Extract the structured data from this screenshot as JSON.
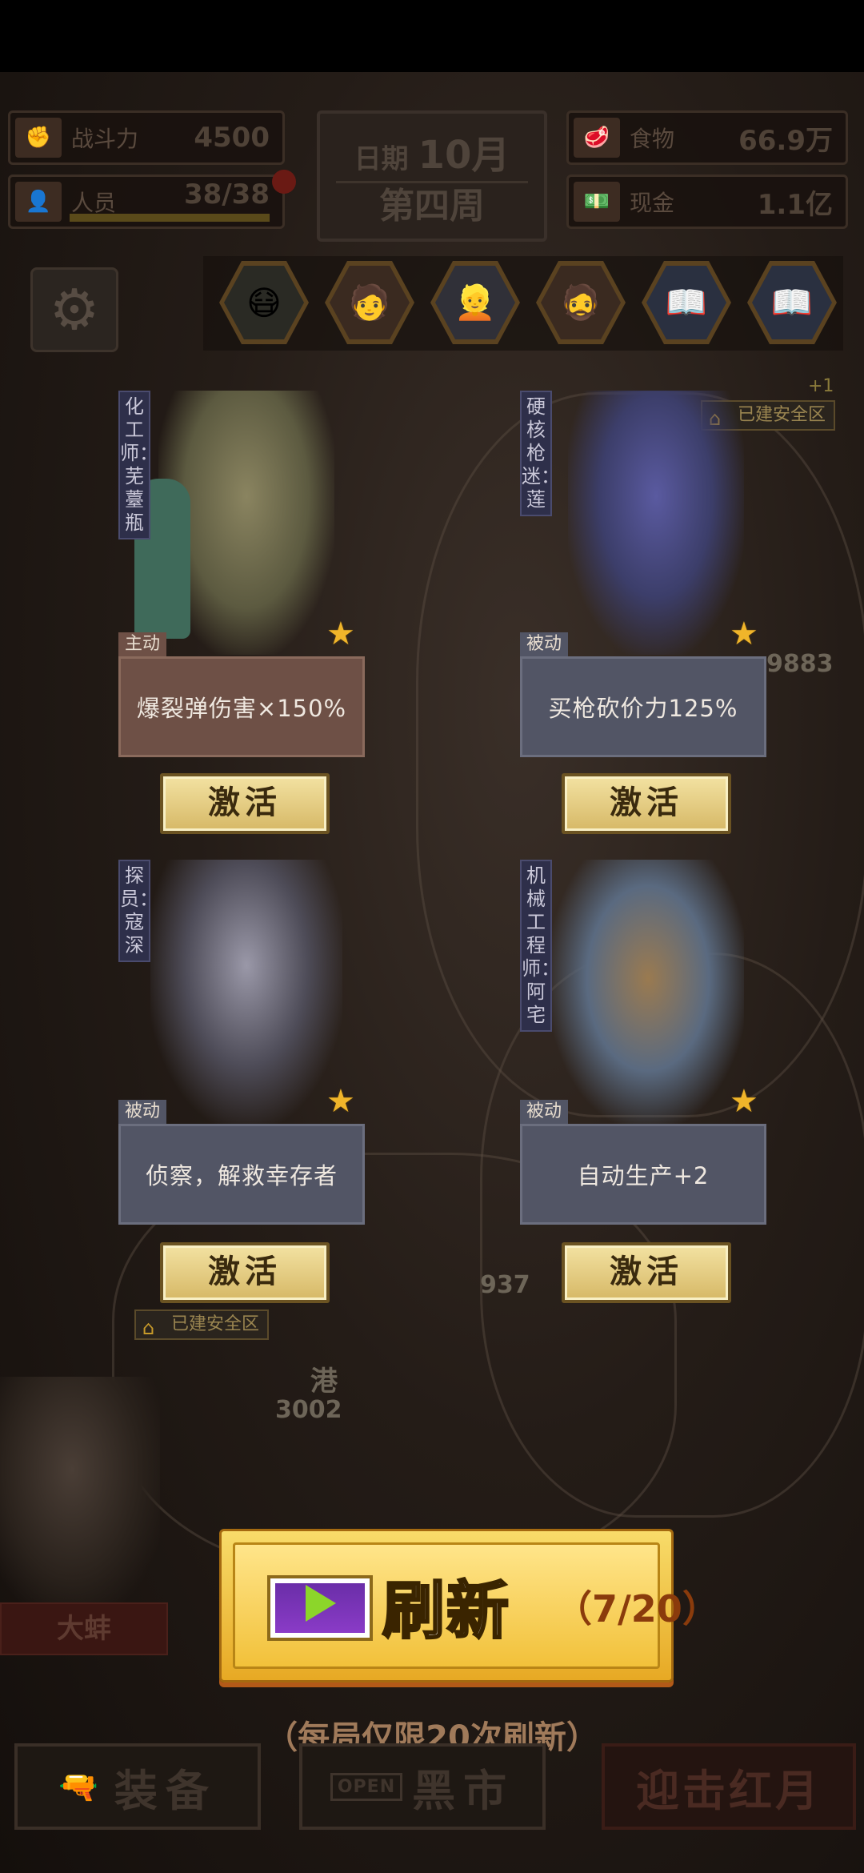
{
  "stats": {
    "combat": {
      "label": "战斗力",
      "value": "4500",
      "icon": "fist-icon"
    },
    "staff": {
      "label": "人员",
      "value": "38/38",
      "icon": "person-icon"
    },
    "food": {
      "label": "食物",
      "value": "66.9万",
      "icon": "meat-icon"
    },
    "cash": {
      "label": "现金",
      "value": "1.1亿",
      "icon": "cash-icon"
    }
  },
  "date": {
    "label": "日期",
    "month": "10月",
    "week": "第四周"
  },
  "map": {
    "safe_zone_label": "已建安全区",
    "plus_badge": "+1",
    "numbers": [
      "9883",
      "937",
      "3002"
    ],
    "place": "港"
  },
  "characters": [
    {
      "name": "化工师：芜薹瓶",
      "type": "主动",
      "desc": "爆裂弹伤害×150%",
      "button": "激活"
    },
    {
      "name": "硬核枪迷：莲",
      "type": "被动",
      "desc": "买枪砍价力125%",
      "button": "激活"
    },
    {
      "name": "探员：寇深",
      "type": "被动",
      "desc": "侦察，解救幸存者",
      "button": "激活"
    },
    {
      "name": "机械工程师：阿宅",
      "type": "被动",
      "desc": "自动生产+2",
      "button": "激活"
    }
  ],
  "side_character": {
    "label": "大蚌"
  },
  "refresh": {
    "label": "刷新",
    "count": "（7/20）",
    "note": "（每局仅限20次刷新）"
  },
  "bottom_nav": {
    "equip": "装备",
    "black_market": "黑市",
    "battle": "迎击红月",
    "open_sign": "OPEN"
  },
  "colors": {
    "gold": "#f2c13a",
    "active_card": "#6e5046",
    "passive_card": "#525565",
    "star": "#f0b52a"
  }
}
